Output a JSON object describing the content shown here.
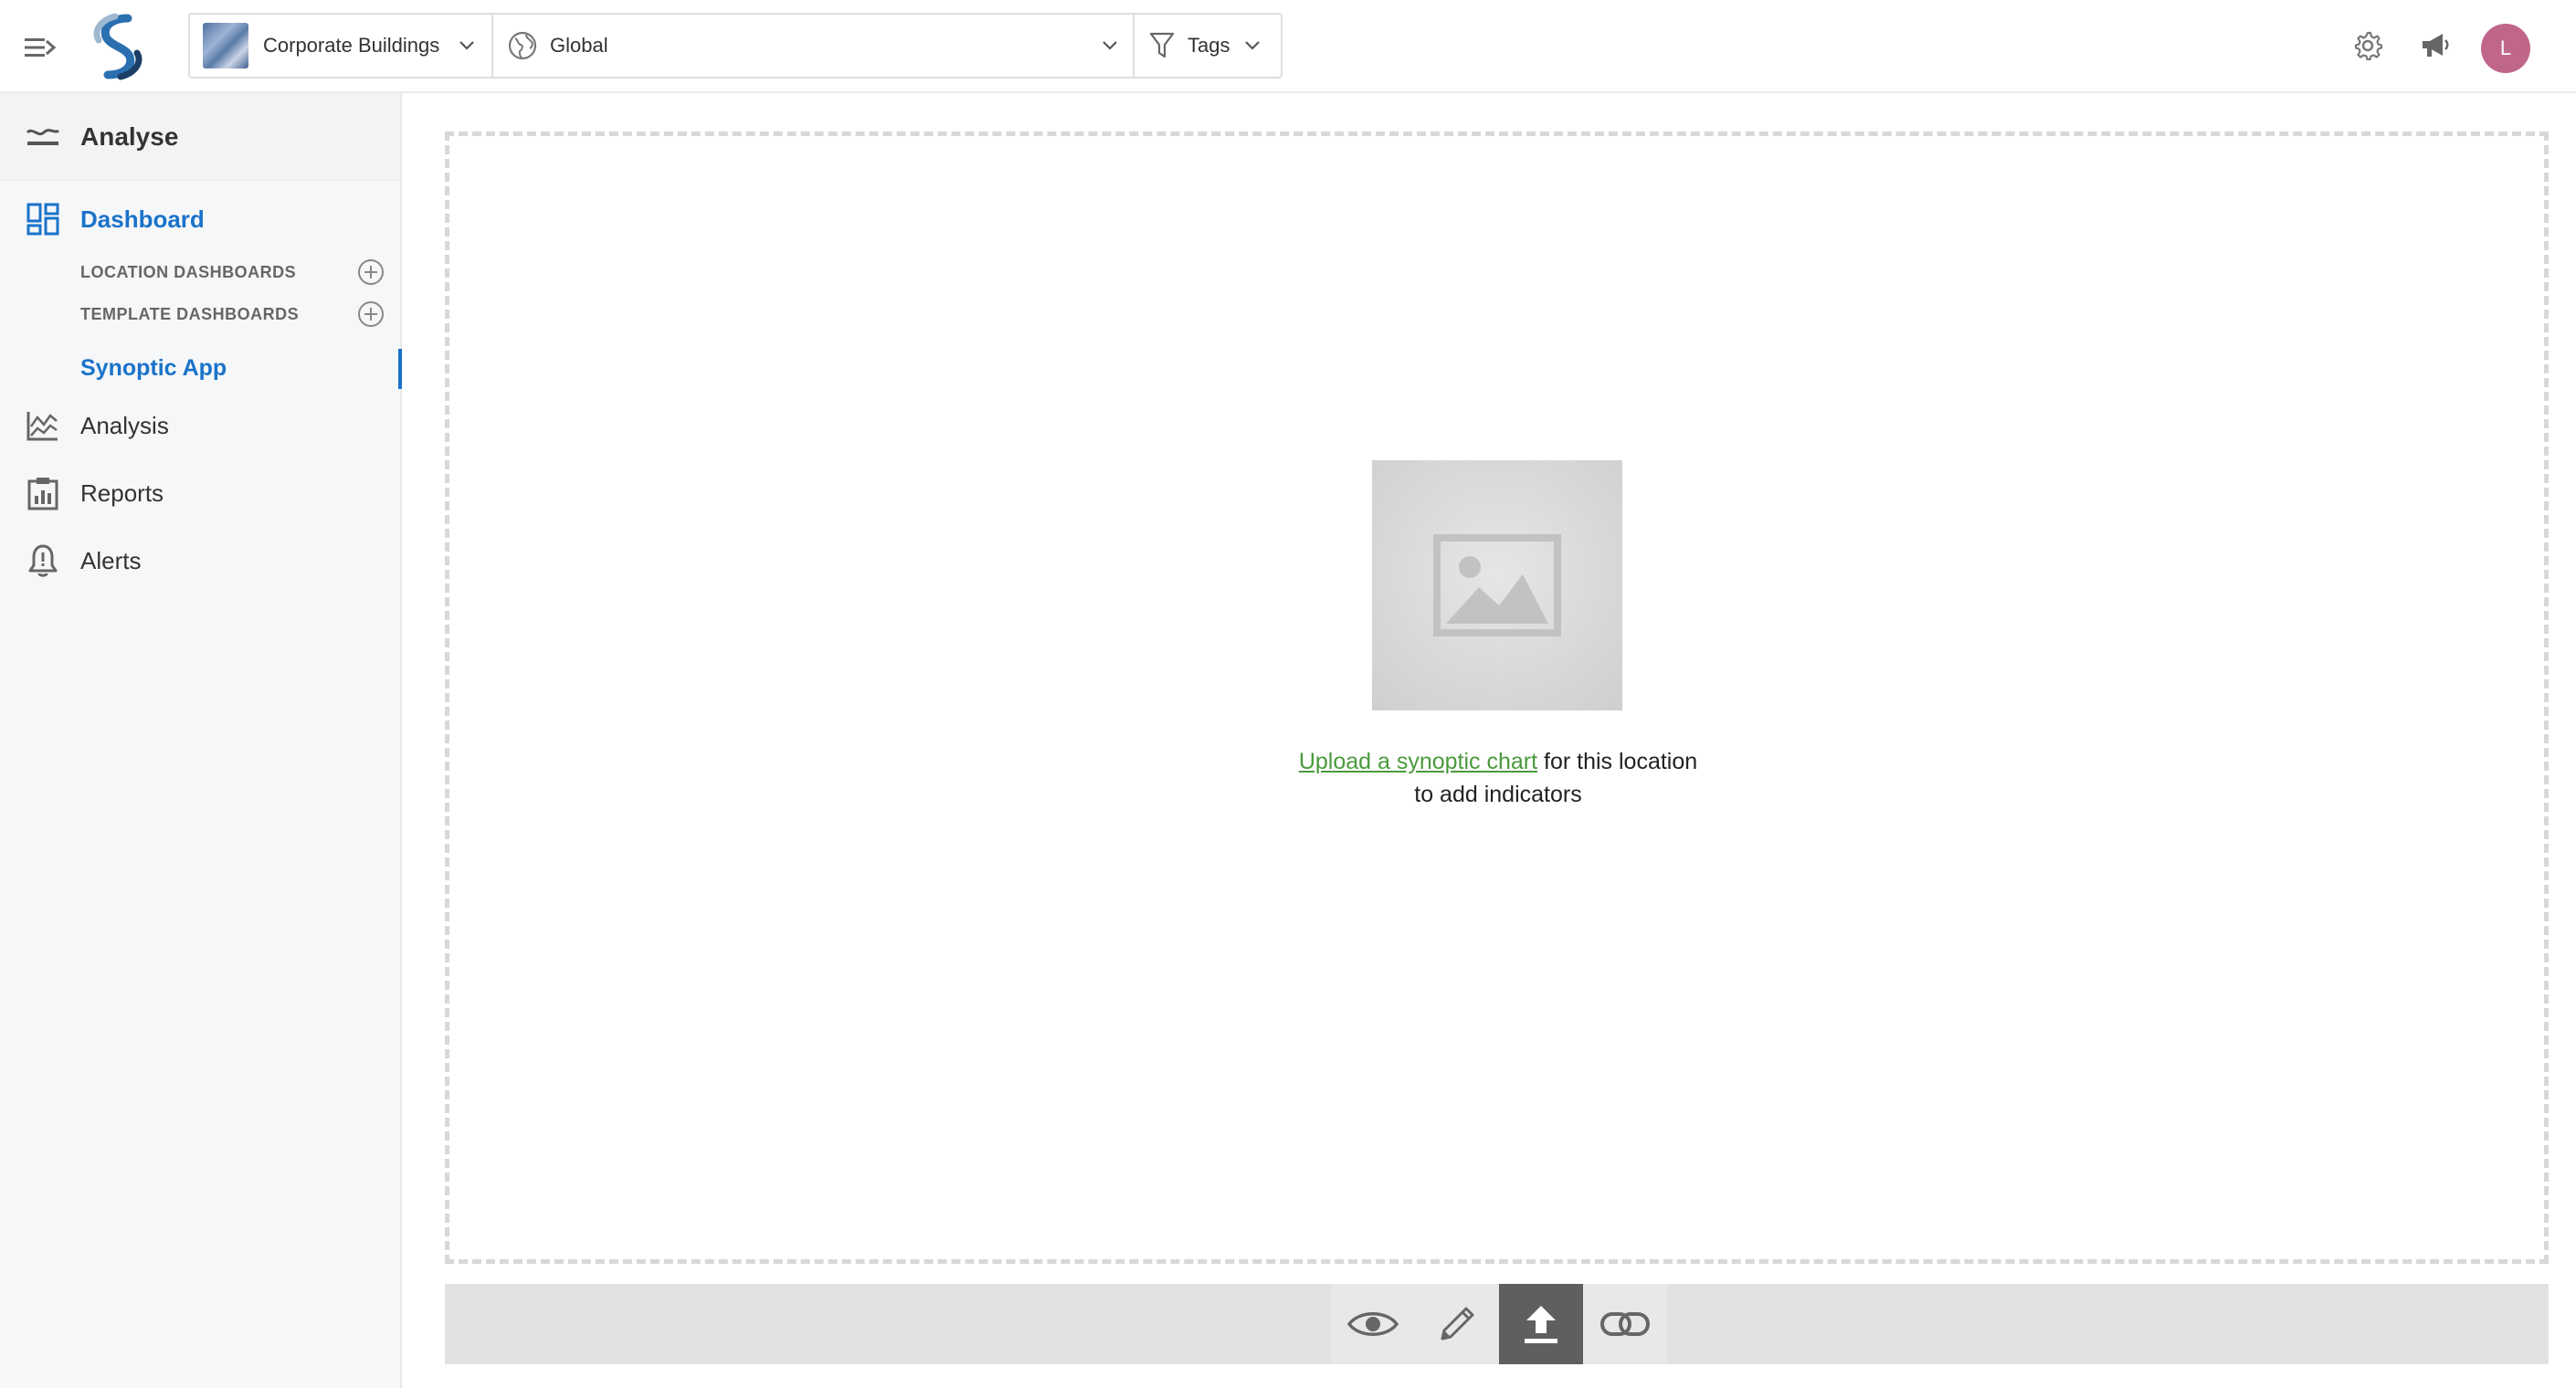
{
  "topbar": {
    "location_label": "Corporate Buildings",
    "region_label": "Global",
    "tags_label": "Tags",
    "avatar_initial": "L"
  },
  "sidebar": {
    "section_title": "Analyse",
    "dashboard_label": "Dashboard",
    "location_dashboards_label": "LOCATION DASHBOARDS",
    "template_dashboards_label": "TEMPLATE DASHBOARDS",
    "active_app_label": "Synoptic App",
    "items": [
      {
        "label": "Analysis",
        "icon": "line-chart-icon"
      },
      {
        "label": "Reports",
        "icon": "clipboard-chart-icon"
      },
      {
        "label": "Alerts",
        "icon": "bell-icon"
      }
    ]
  },
  "main": {
    "upload_link_text": "Upload a synoptic chart",
    "upload_text_rest": " for this location",
    "upload_text_line2": "to add indicators"
  },
  "colors": {
    "accent": "#1a73c9",
    "link_green": "#4a9a3c",
    "avatar": "#c0668a",
    "tool_selected": "#5f5f5f"
  },
  "toolbar": {
    "buttons": [
      {
        "icon": "eye-icon",
        "selected": false
      },
      {
        "icon": "pencil-icon",
        "selected": false
      },
      {
        "icon": "upload-icon",
        "selected": true
      },
      {
        "icon": "link-icon",
        "selected": false
      }
    ]
  }
}
